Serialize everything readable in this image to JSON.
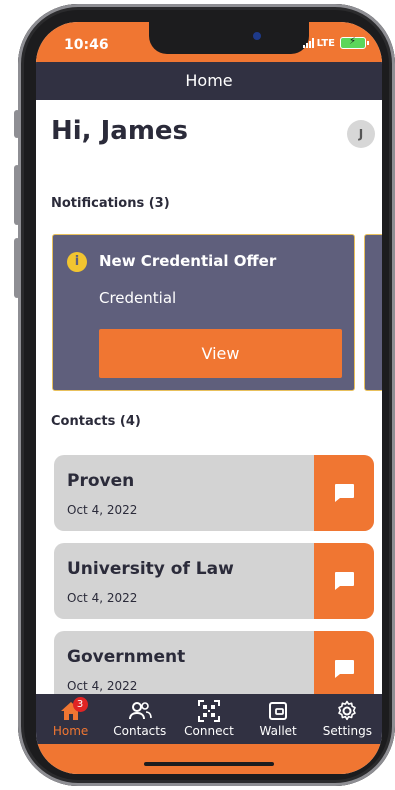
{
  "status_bar": {
    "time": "10:46",
    "network": "LTE"
  },
  "header": {
    "title": "Home"
  },
  "greeting": "Hi, James",
  "avatar_initial": "J",
  "notifications": {
    "title": "Notifications (3)",
    "items": [
      {
        "title": "New Credential Offer",
        "subtitle": "Credential",
        "action": "View",
        "icon": "info-icon"
      }
    ]
  },
  "contacts": {
    "title": "Contacts (4)",
    "items": [
      {
        "name": "Proven",
        "date": "Oct 4, 2022"
      },
      {
        "name": "University of Law",
        "date": "Oct 4, 2022"
      },
      {
        "name": "Government",
        "date": "Oct 4, 2022"
      }
    ]
  },
  "tabs": [
    {
      "label": "Home",
      "icon": "home-icon",
      "badge": "3",
      "active": true
    },
    {
      "label": "Contacts",
      "icon": "contacts-icon"
    },
    {
      "label": "Connect",
      "icon": "qr-code-icon"
    },
    {
      "label": "Wallet",
      "icon": "wallet-icon"
    },
    {
      "label": "Settings",
      "icon": "gear-icon"
    }
  ],
  "colors": {
    "accent": "#f07632",
    "header": "#313142",
    "card": "#5f5f7c",
    "card_border": "#e8c05c"
  }
}
